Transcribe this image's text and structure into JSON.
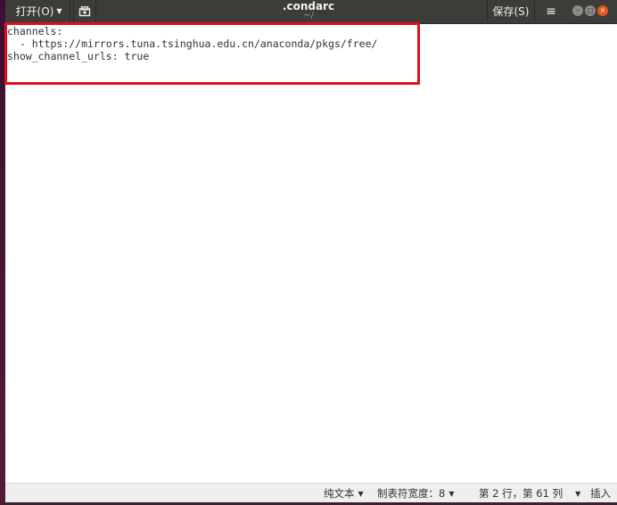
{
  "headerbar": {
    "open_label": "打开(O)",
    "title": ".condarc",
    "subtitle": "~/",
    "save_label": "保存(S)"
  },
  "editor": {
    "lines": [
      "channels:",
      "  - https://mirrors.tuna.tsinghua.edu.cn/anaconda/pkgs/free/",
      "show_channel_urls: true"
    ]
  },
  "statusbar": {
    "syntax": "纯文本",
    "tab_width": "制表符宽度：8",
    "position": "第 2 行，第 61 列",
    "insert_mode": "插入"
  },
  "colors": {
    "highlight": "#e0101a",
    "headerbar": "#3d3c38",
    "close_button": "#e95420"
  },
  "icons": {
    "new_tab": "new-tab-icon",
    "menu": "hamburger-menu-icon"
  }
}
